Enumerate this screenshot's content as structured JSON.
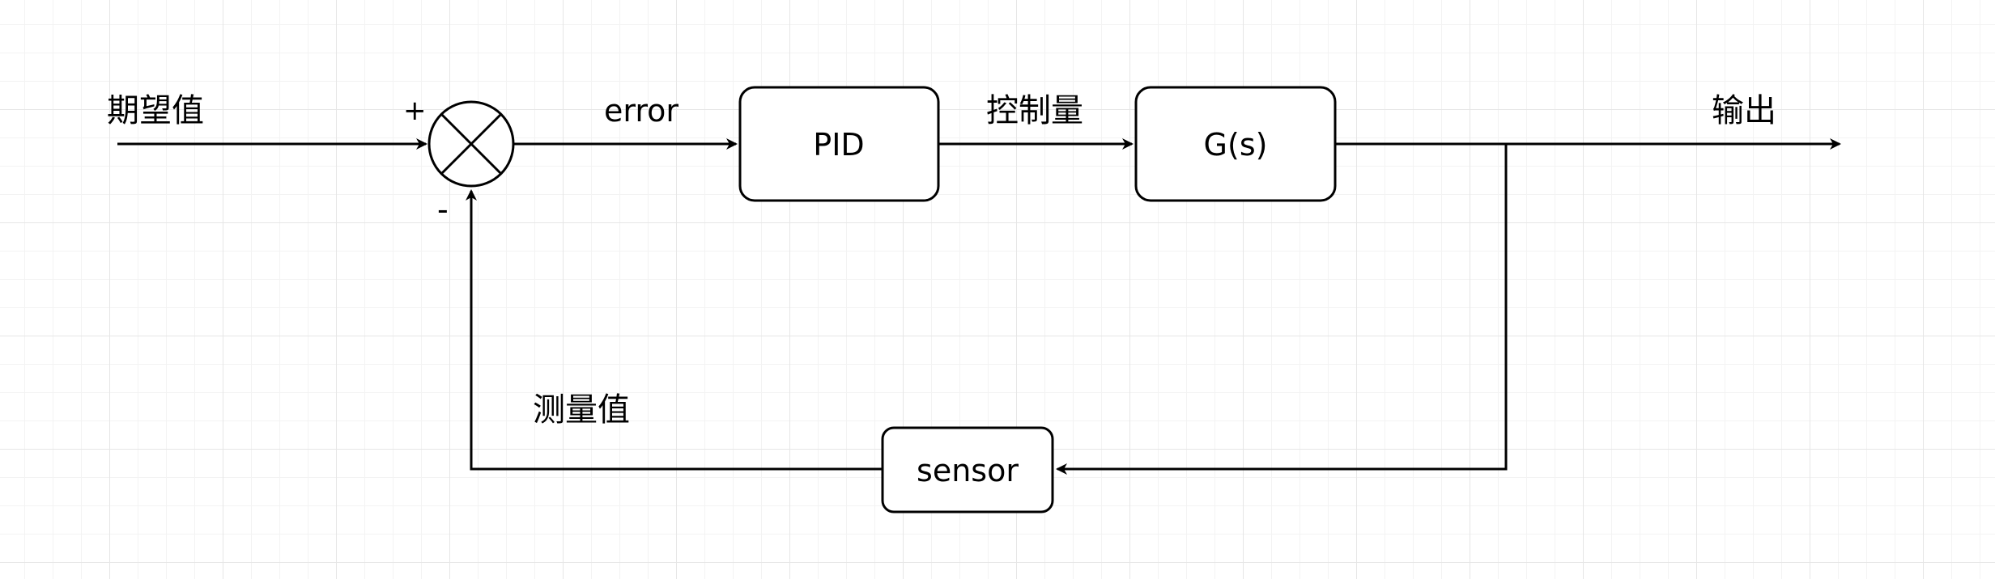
{
  "diagram": {
    "setpoint_label": "期望值",
    "plus_sign": "+",
    "minus_sign": "-",
    "error_label": "error",
    "controller_label": "PID",
    "control_signal_label": "控制量",
    "plant_label": "G(s)",
    "output_label": "输出",
    "measurement_label": "测量值",
    "sensor_label": "sensor"
  },
  "colors": {
    "stroke": "#000000",
    "grid": "#e6e6e6",
    "background": "#ffffff"
  }
}
